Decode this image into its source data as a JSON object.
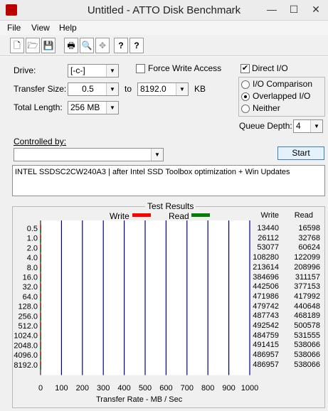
{
  "window": {
    "title": "Untitled - ATTO Disk Benchmark",
    "minimize": "—",
    "maximize": "☐",
    "close": "✕"
  },
  "menu": [
    "File",
    "View",
    "Help"
  ],
  "toolbar": {
    "new": "🗋",
    "open": "🗁",
    "save": "💾",
    "print": "🖶",
    "preview": "🔍",
    "move": "✥",
    "help": "?",
    "context_help": "?"
  },
  "settings": {
    "drive_label": "Drive:",
    "drive_value": "[-c-]",
    "force_write_label": "Force Write Access",
    "force_write_checked": false,
    "direct_io_label": "Direct I/O",
    "direct_io_checked": true,
    "transfer_size_label": "Transfer Size:",
    "transfer_from": "0.5",
    "to_label": "to",
    "transfer_to": "8192.0",
    "kb_label": "KB",
    "total_length_label": "Total Length:",
    "total_length_value": "256 MB",
    "io_options": [
      "I/O Comparison",
      "Overlapped I/O",
      "Neither"
    ],
    "io_selected": 1,
    "queue_depth_label": "Queue Depth:",
    "queue_depth_value": "4",
    "controlled_by_label": "Controlled by:",
    "controlled_by_value": "",
    "start_label": "Start",
    "description": "INTEL SSDSC2CW240A3 | after Intel SSD Toolbox optimization + Win Updates"
  },
  "results": {
    "group_title": "Test Results",
    "legend_write": "Write",
    "legend_read": "Read",
    "col_write": "Write",
    "col_read": "Read",
    "write_color": "#ff0000",
    "read_color": "#008000"
  },
  "chart_data": {
    "type": "bar",
    "orientation": "horizontal",
    "categories": [
      "0.5",
      "1.0",
      "2.0",
      "4.0",
      "8.0",
      "16.0",
      "32.0",
      "64.0",
      "128.0",
      "256.0",
      "512.0",
      "1024.0",
      "2048.0",
      "4096.0",
      "8192.0"
    ],
    "series": [
      {
        "name": "Write",
        "values": [
          13440,
          26112,
          53077,
          108280,
          213614,
          384696,
          442506,
          471986,
          479742,
          487743,
          492542,
          484759,
          491415,
          486957,
          486957
        ]
      },
      {
        "name": "Read",
        "values": [
          16598,
          32768,
          60624,
          122099,
          208996,
          311157,
          377153,
          417992,
          440648,
          468189,
          500578,
          531555,
          538066,
          538066,
          538066
        ]
      }
    ],
    "xlabel": "Transfer Rate - MB / Sec",
    "xticks": [
      "0",
      "100",
      "200",
      "300",
      "400",
      "500",
      "600",
      "700",
      "800",
      "900",
      "1000"
    ],
    "xlim": [
      0,
      1000
    ],
    "grid": true
  }
}
